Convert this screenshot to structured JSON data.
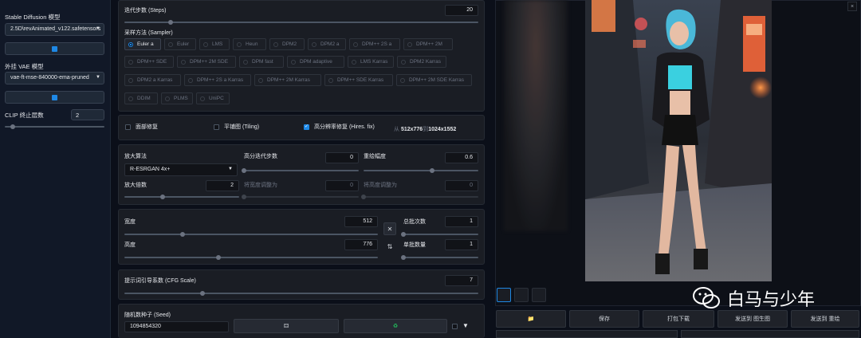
{
  "sidebar": {
    "model_label": "Stable Diffusion 模型",
    "model_value": "2.5D\\revAnimated_v122.safetensors",
    "vae_label": "外挂 VAE 模型",
    "vae_value": "vae-ft-mse-840000-ema-pruned",
    "clip_label": "CLIP 终止层数",
    "clip_value": "2",
    "clip_slider_fraction": 0.08
  },
  "steps": {
    "label": "迭代步数 (Steps)",
    "value": "20",
    "slider_fraction": 0.13
  },
  "sampler": {
    "label": "采样方法 (Sampler)",
    "selected": "Euler a",
    "options": [
      "Euler a",
      "Euler",
      "LMS",
      "Heun",
      "DPM2",
      "DPM2 a",
      "DPM++ 2S a",
      "DPM++ 2M",
      "DPM++ SDE",
      "DPM++ 2M SDE",
      "DPM fast",
      "DPM adaptive",
      "LMS Karras",
      "DPM2 Karras",
      "DPM2 a Karras",
      "DPM++ 2S a Karras",
      "DPM++ 2M Karras",
      "DPM++ SDE Karras",
      "DPM++ 2M SDE Karras",
      "DDIM",
      "PLMS",
      "UniPC"
    ]
  },
  "options_row": {
    "face_restore": "面部修复",
    "tiling": "平铺图 (Tiling)",
    "hires": "高分辨率修复 (Hires. fix)",
    "hires_checked": true,
    "resize_from": "从",
    "size_from": "512x776",
    "resize_to": "到",
    "size_to": "1024x1552"
  },
  "hires": {
    "upscaler_label": "放大算法",
    "upscaler_value": "R-ESRGAN 4x+",
    "hires_steps_label": "高分迭代步数",
    "hires_steps_value": "0",
    "denoise_label": "重绘幅度",
    "denoise_value": "0.6",
    "denoise_fraction": 0.6,
    "scale_label": "放大倍数",
    "scale_value": "2",
    "scale_fraction": 0.33,
    "resize_w_label": "将宽度调整为",
    "resize_w_value": "0",
    "resize_h_label": "将高度调整为",
    "resize_h_value": "0"
  },
  "dimensions": {
    "width_label": "宽度",
    "width_value": "512",
    "width_fraction": 0.23,
    "height_label": "高度",
    "height_value": "776",
    "height_fraction": 0.37,
    "batch_count_label": "总批次数",
    "batch_count_value": "1",
    "batch_size_label": "单批数量",
    "batch_size_value": "1",
    "swap_icon": "✕",
    "swap2_icon": "⇅"
  },
  "cfg": {
    "label": "提示词引导系数 (CFG Scale)",
    "value": "7",
    "slider_fraction": 0.22
  },
  "seed": {
    "label": "随机数种子 (Seed)",
    "value": "1094854320",
    "dice_icon": "⚃",
    "recycle_icon": "♻",
    "extra_icon": "▼"
  },
  "gallery": {
    "close_icon": "×",
    "actions": [
      "📁",
      "保存",
      "打包下载",
      "发送到 图生图",
      "发送到 重绘"
    ]
  },
  "watermark": {
    "text": "白马与少年"
  }
}
